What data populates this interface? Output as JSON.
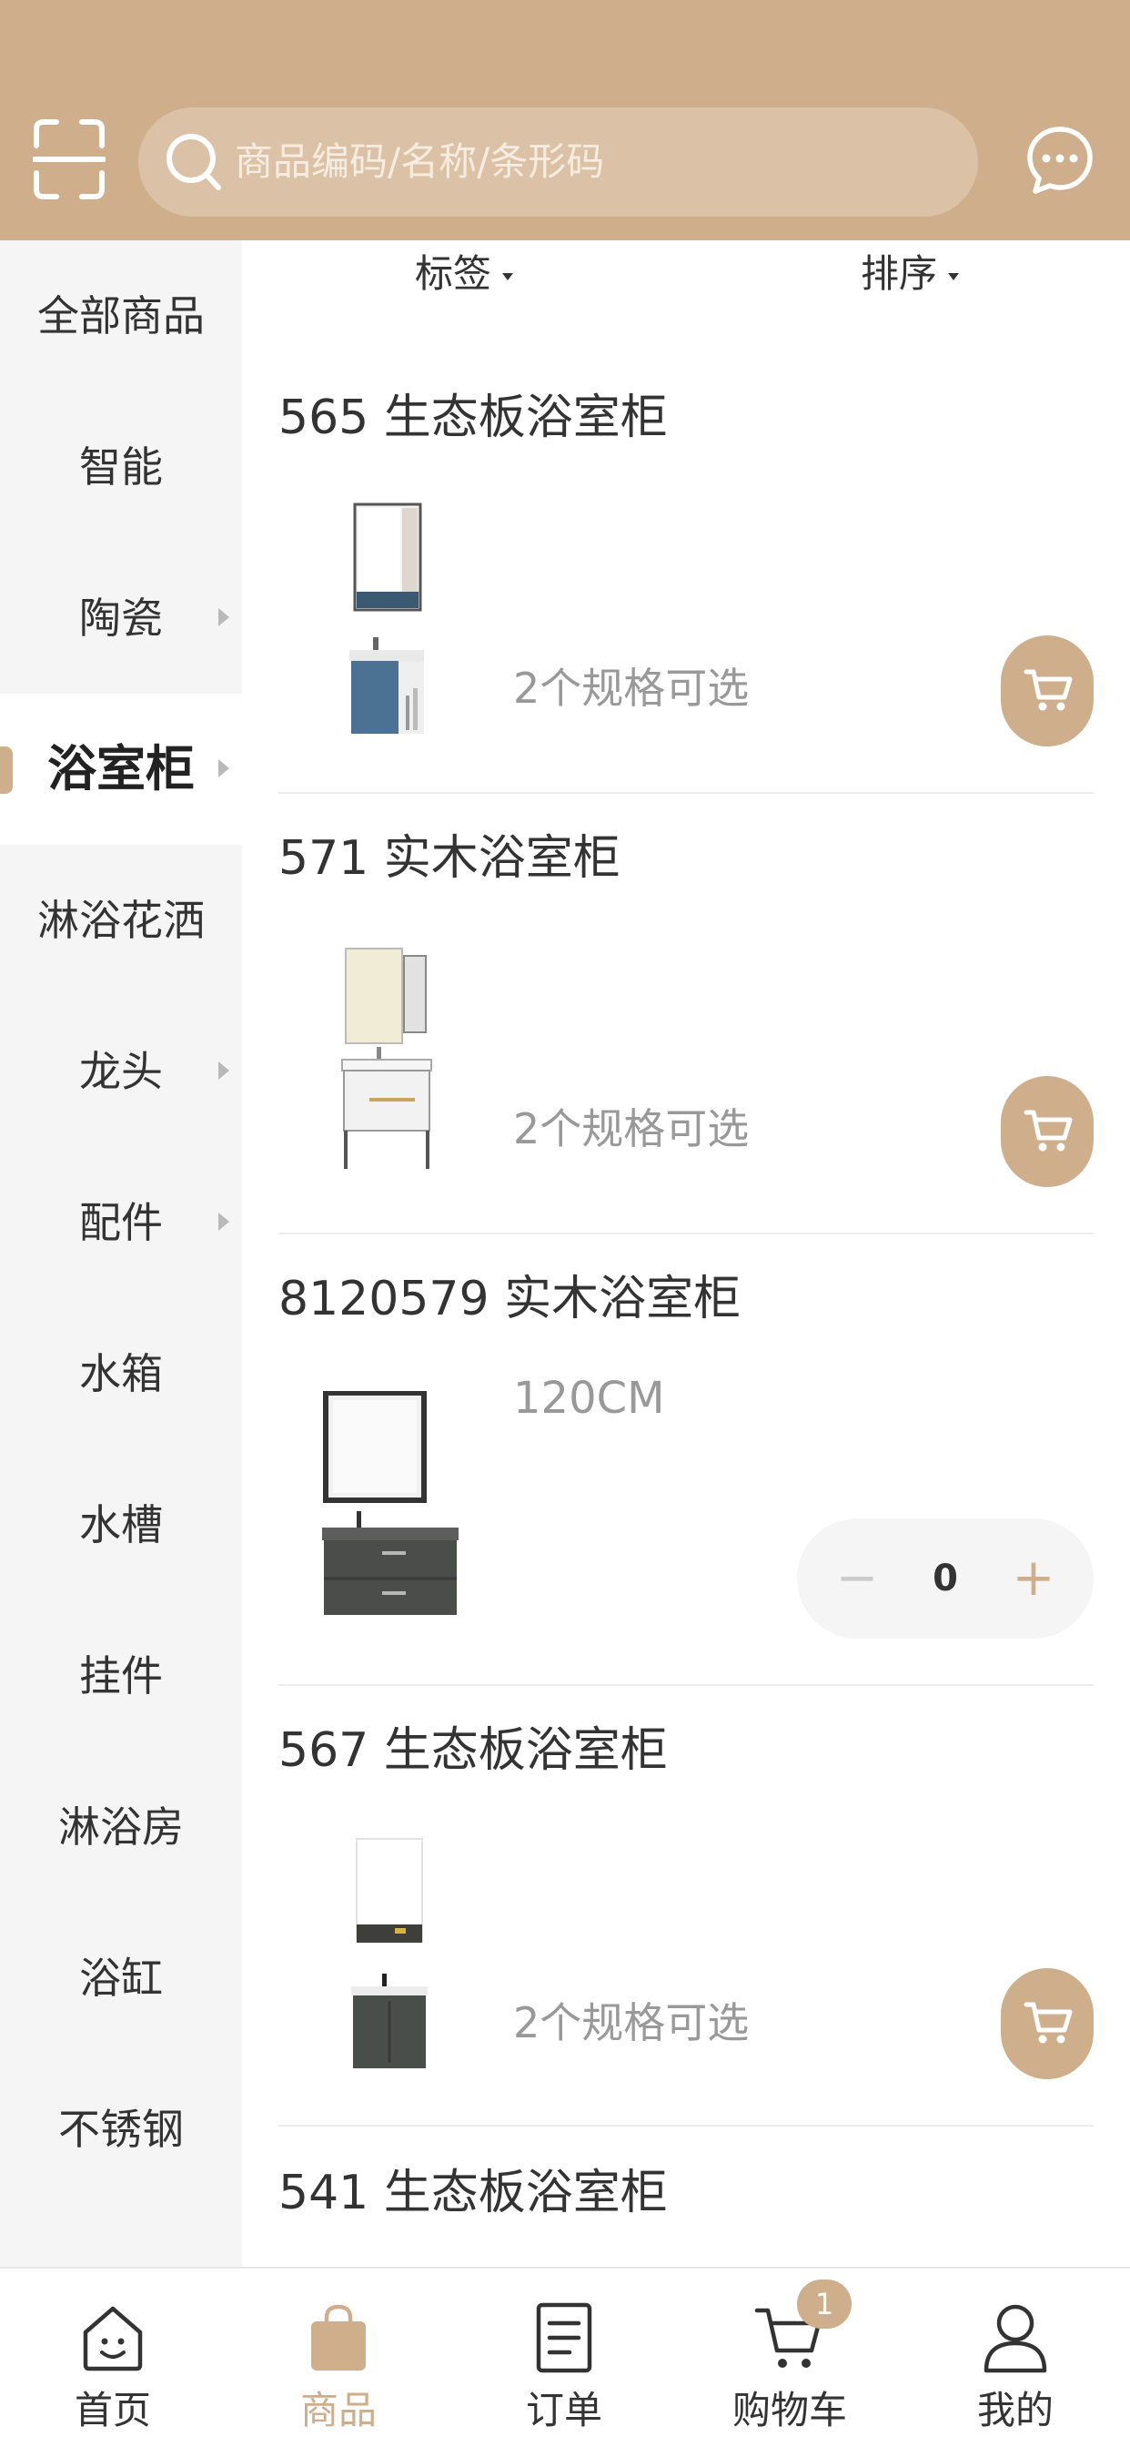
{
  "header": {
    "search_placeholder": "商品编码/名称/条形码"
  },
  "filters": {
    "tag_label": "标签",
    "sort_label": "排序"
  },
  "sidebar": {
    "items": [
      {
        "label": "全部商品",
        "has_arrow": false
      },
      {
        "label": "智能",
        "has_arrow": false
      },
      {
        "label": "陶瓷",
        "has_arrow": true
      },
      {
        "label": "浴室柜",
        "has_arrow": true,
        "active": true
      },
      {
        "label": "淋浴花洒",
        "has_arrow": false
      },
      {
        "label": "龙头",
        "has_arrow": true
      },
      {
        "label": "配件",
        "has_arrow": true
      },
      {
        "label": "水箱",
        "has_arrow": false
      },
      {
        "label": "水槽",
        "has_arrow": false
      },
      {
        "label": "挂件",
        "has_arrow": false
      },
      {
        "label": "淋浴房",
        "has_arrow": false
      },
      {
        "label": "浴缸",
        "has_arrow": false
      },
      {
        "label": "不锈钢",
        "has_arrow": false
      }
    ]
  },
  "products": [
    {
      "title": "565 生态板浴室柜",
      "spec": "2个规格可选",
      "action": "cart"
    },
    {
      "title": "571 实木浴室柜",
      "spec": "2个规格可选",
      "action": "cart"
    },
    {
      "title": "8120579 实木浴室柜",
      "size": "120CM",
      "action": "stepper",
      "quantity": "0",
      "minus": "−",
      "plus": "+"
    },
    {
      "title": "567 生态板浴室柜",
      "spec": "2个规格可选",
      "action": "cart"
    },
    {
      "title": "541 生态板浴室柜"
    }
  ],
  "tabbar": {
    "items": [
      {
        "label": "首页",
        "icon": "home-icon"
      },
      {
        "label": "商品",
        "icon": "bag-icon",
        "active": true
      },
      {
        "label": "订单",
        "icon": "order-icon"
      },
      {
        "label": "购物车",
        "icon": "cart-icon",
        "badge": "1"
      },
      {
        "label": "我的",
        "icon": "user-icon"
      }
    ]
  },
  "colors": {
    "accent": "#cfae8b",
    "header_bg": "#cfae8b",
    "sidebar_bg": "#f5f5f5",
    "muted_text": "#999999"
  }
}
